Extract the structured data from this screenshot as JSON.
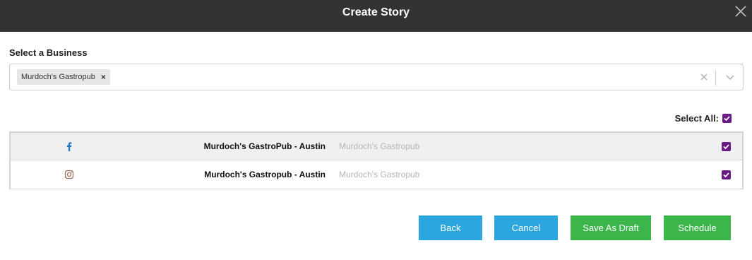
{
  "dialog": {
    "title": "Create Story",
    "close_icon": "close-icon"
  },
  "business_select": {
    "label": "Select a Business",
    "selected_chip": "Murdoch's Gastropub",
    "chip_remove": "×"
  },
  "select_all": {
    "label": "Select All:",
    "checked": true
  },
  "accounts": [
    {
      "network": "facebook-icon",
      "name": "Murdoch's GastroPub - Austin",
      "business": "Murdoch's Gastropub",
      "checked": true
    },
    {
      "network": "instagram-icon",
      "name": "Murdoch's Gastropub - Austin",
      "business": "Murdoch's Gastropub",
      "checked": true
    }
  ],
  "buttons": {
    "back": "Back",
    "cancel": "Cancel",
    "save_draft": "Save As Draft",
    "schedule": "Schedule"
  },
  "colors": {
    "header": "#333333",
    "accent_blue": "#2ba6de",
    "accent_green": "#3cb54a",
    "checkbox": "#6a1a86",
    "facebook": "#1877c9",
    "instagram": "#a0705a"
  }
}
